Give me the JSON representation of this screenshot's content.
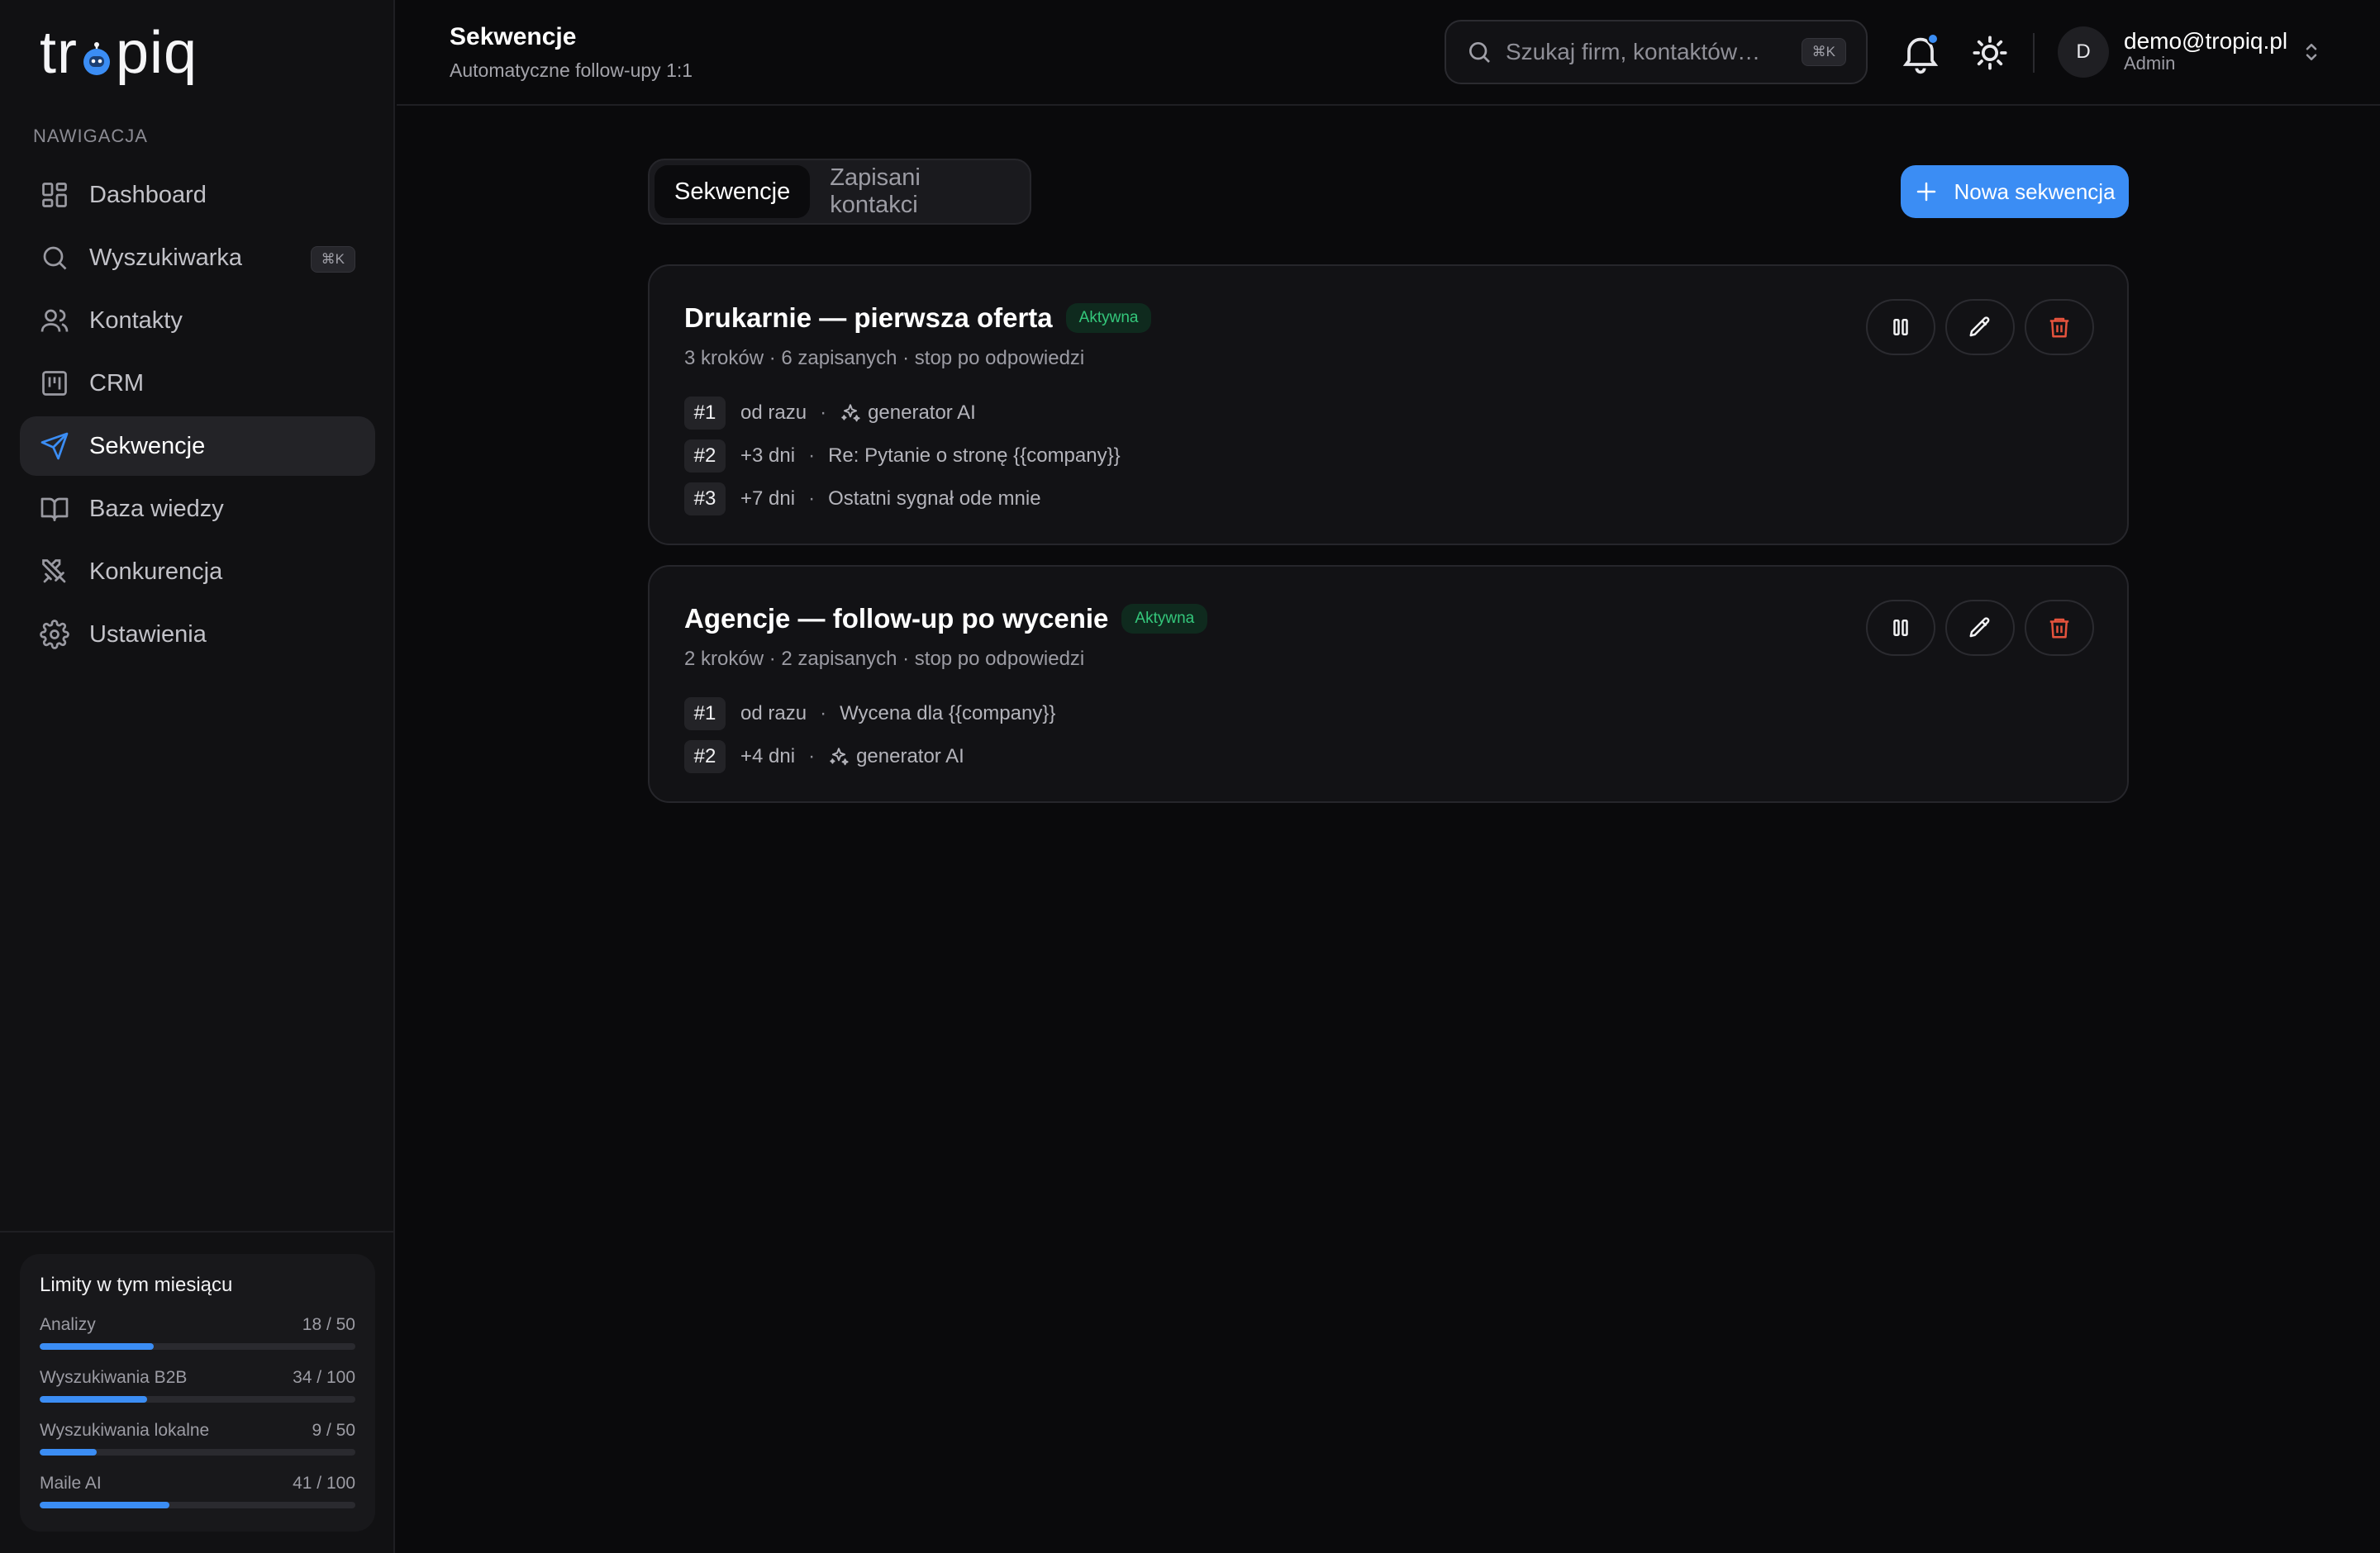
{
  "brand": {
    "logo_text_left": "tr",
    "logo_text_right": "piq"
  },
  "sidebar": {
    "heading": "NAWIGACJA",
    "items": [
      {
        "label": "Dashboard",
        "icon": "dashboard-icon"
      },
      {
        "label": "Wyszukiwarka",
        "icon": "search-icon",
        "shortcut": "⌘K"
      },
      {
        "label": "Kontakty",
        "icon": "users-icon"
      },
      {
        "label": "CRM",
        "icon": "kanban-icon"
      },
      {
        "label": "Sekwencje",
        "icon": "send-icon",
        "active": true
      },
      {
        "label": "Baza wiedzy",
        "icon": "book-icon"
      },
      {
        "label": "Konkurencja",
        "icon": "swords-icon"
      },
      {
        "label": "Ustawienia",
        "icon": "gear-icon"
      }
    ],
    "limits": {
      "title": "Limity w tym miesiącu",
      "rows": [
        {
          "label": "Analizy",
          "value": "18 / 50",
          "fraction": 0.36
        },
        {
          "label": "Wyszukiwania B2B",
          "value": "34 / 100",
          "fraction": 0.34
        },
        {
          "label": "Wyszukiwania lokalne",
          "value": "9 / 50",
          "fraction": 0.18
        },
        {
          "label": "Maile AI",
          "value": "41 / 100",
          "fraction": 0.41
        }
      ]
    }
  },
  "header": {
    "title": "Sekwencje",
    "subtitle": "Automatyczne follow-upy 1:1",
    "search": {
      "placeholder": "Szukaj firm, kontaktów…",
      "shortcut": "⌘K"
    },
    "user": {
      "initial": "D",
      "email": "demo@tropiq.pl",
      "role": "Admin"
    }
  },
  "tabs": [
    {
      "label": "Sekwencje",
      "active": true
    },
    {
      "label": "Zapisani kontakci",
      "active": false
    }
  ],
  "new_button": "Nowa sekwencja",
  "sequences": [
    {
      "title": "Drukarnie — pierwsza oferta",
      "status": "Aktywna",
      "meta": "3 kroków · 6 zapisanych · stop po odpowiedzi",
      "steps": [
        {
          "num": "#1",
          "delay": "od razu",
          "subject": "generator AI",
          "ai": true
        },
        {
          "num": "#2",
          "delay": "+3 dni",
          "subject": "Re: Pytanie o stronę {{company}}",
          "ai": false
        },
        {
          "num": "#3",
          "delay": "+7 dni",
          "subject": "Ostatni sygnał ode mnie",
          "ai": false
        }
      ]
    },
    {
      "title": "Agencje — follow-up po wycenie",
      "status": "Aktywna",
      "meta": "2 kroków · 2 zapisanych · stop po odpowiedzi",
      "steps": [
        {
          "num": "#1",
          "delay": "od razu",
          "subject": "Wycena dla {{company}}",
          "ai": false
        },
        {
          "num": "#2",
          "delay": "+4 dni",
          "subject": "generator AI",
          "ai": true
        }
      ]
    }
  ],
  "colors": {
    "accent": "#3b8df4",
    "success": "#34c77b",
    "danger": "#e5533d"
  }
}
